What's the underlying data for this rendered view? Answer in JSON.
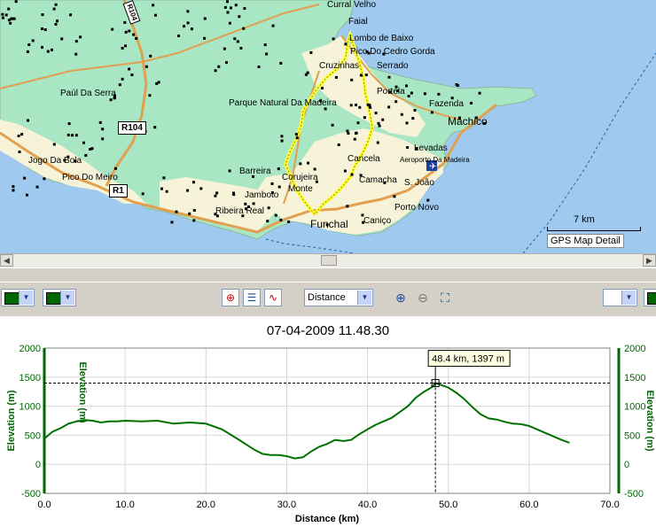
{
  "map": {
    "places": [
      {
        "id": "curral-velho",
        "label": "Curral Velho",
        "big": false
      },
      {
        "id": "faial",
        "label": "Faial",
        "big": false
      },
      {
        "id": "lombo-de-baixo",
        "label": "Lombo de Baixo",
        "big": false
      },
      {
        "id": "pico-do-cedro-gorda",
        "label": "Pico Do Cedro Gorda",
        "big": false
      },
      {
        "id": "cruzinhas",
        "label": "Cruzinhas",
        "big": false
      },
      {
        "id": "serrado",
        "label": "Serrado",
        "big": false
      },
      {
        "id": "paul-da-serra",
        "label": "Paúl Da Serra",
        "big": false
      },
      {
        "id": "parque-natural",
        "label": "Parque Natural Da Madeira",
        "big": false
      },
      {
        "id": "portela",
        "label": "Portela",
        "big": false
      },
      {
        "id": "fazenda",
        "label": "Fazenda",
        "big": false
      },
      {
        "id": "machico",
        "label": "Machico",
        "big": true
      },
      {
        "id": "levadas",
        "label": "Levadas",
        "big": false
      },
      {
        "id": "aeroporto",
        "label": "Aeroporto Da Madeira",
        "big": false
      },
      {
        "id": "jogo-da-bola",
        "label": "Jogo Da Bola",
        "big": false
      },
      {
        "id": "pico-do-meiro",
        "label": "Pico Do Meiro",
        "big": false
      },
      {
        "id": "barreira",
        "label": "Barreira",
        "big": false
      },
      {
        "id": "cancela",
        "label": "Cancela",
        "big": false
      },
      {
        "id": "corujeira",
        "label": "Corujeira",
        "big": false
      },
      {
        "id": "camacha",
        "label": "Camacha",
        "big": false
      },
      {
        "id": "s-joao",
        "label": "S. João",
        "big": false
      },
      {
        "id": "monte",
        "label": "Monte",
        "big": false
      },
      {
        "id": "jamboto",
        "label": "Jamboto",
        "big": false
      },
      {
        "id": "ribeira-real",
        "label": "Ribeira Real",
        "big": false
      },
      {
        "id": "porto-novo",
        "label": "Porto Novo",
        "big": false
      },
      {
        "id": "funchal",
        "label": "Funchal",
        "big": true
      },
      {
        "id": "canico",
        "label": "Caniço",
        "big": false
      }
    ],
    "road_shields": [
      {
        "id": "r104",
        "label": "R104"
      },
      {
        "id": "r1",
        "label": "R1"
      },
      {
        "id": "r101",
        "label": "R104"
      }
    ],
    "scale_label": "7 km",
    "detail_label": "GPS Map Detail",
    "colors": {
      "sea": "#9fc9ee",
      "land": "#a8e6c4",
      "urban": "#f7f3d9",
      "road": "#e0a050",
      "track": "#ffff33",
      "poi": "#000000"
    }
  },
  "toolbar": {
    "left_color": "#006600",
    "x_axis_select": "Distance",
    "icons": [
      "crosshair-icon",
      "split-view-icon",
      "profile-curve-icon",
      "zoom-in-icon",
      "zoom-out-icon",
      "zoom-extent-icon"
    ]
  },
  "profile": {
    "title": "07-04-2009 11.48.30",
    "cursor_label": "48.4 km, 1397 m"
  },
  "chart_data": {
    "type": "line",
    "title": "07-04-2009 11.48.30",
    "xlabel": "Distance (km)",
    "ylabel": "Elevation (m)",
    "xlim": [
      0,
      70
    ],
    "ylim": [
      -500,
      2000
    ],
    "xticks": [
      0,
      10,
      20,
      30,
      40,
      50,
      60,
      70
    ],
    "yticks": [
      -500,
      0,
      500,
      1000,
      1500,
      2000
    ],
    "grid": true,
    "series": [
      {
        "color": "#007000",
        "x": [
          0,
          1,
          2,
          3,
          4,
          5,
          6,
          7,
          8,
          9,
          10,
          12,
          14,
          16,
          18,
          20,
          22,
          24,
          26,
          27,
          28,
          29,
          30,
          31,
          32,
          33,
          34,
          35,
          36,
          37,
          38,
          39,
          40,
          41,
          42,
          43,
          44,
          45,
          46,
          47,
          48,
          48.4,
          49,
          50,
          51,
          52,
          53,
          54,
          55,
          56,
          57,
          58,
          59,
          60,
          61,
          62,
          63,
          64,
          65
        ],
        "y": [
          440,
          560,
          620,
          700,
          740,
          760,
          750,
          720,
          740,
          740,
          750,
          740,
          750,
          700,
          720,
          700,
          600,
          430,
          250,
          180,
          160,
          160,
          140,
          100,
          120,
          220,
          300,
          350,
          420,
          400,
          420,
          520,
          600,
          680,
          740,
          800,
          900,
          1000,
          1150,
          1250,
          1330,
          1397,
          1370,
          1320,
          1230,
          1120,
          980,
          860,
          790,
          770,
          730,
          700,
          690,
          660,
          600,
          540,
          480,
          420,
          370
        ]
      }
    ],
    "cursor": {
      "x": 48.4,
      "y": 1397,
      "label": "48.4 km, 1397 m"
    }
  }
}
